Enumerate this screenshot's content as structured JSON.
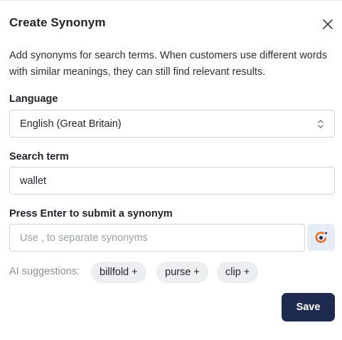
{
  "dialog": {
    "title": "Create Synonym",
    "close_icon": "close-icon",
    "description": "Add synonyms for search terms. When customers use different words with similar meanings, they can still find relevant results."
  },
  "language": {
    "label": "Language",
    "selected": "English (Great Britain)",
    "chevron_icon": "chevron-up-down-icon"
  },
  "search_term": {
    "label": "Search term",
    "value": "wallet"
  },
  "synonym": {
    "label": "Press Enter to submit a synonym",
    "placeholder": "Use , to separate synonyms",
    "ai_icon": "ai-sparkle-icon"
  },
  "ai_suggestions": {
    "label": "AI suggestions:",
    "items": [
      "billfold +",
      "purse +",
      "clip +"
    ]
  },
  "actions": {
    "save_label": "Save"
  },
  "colors": {
    "primary": "#1e2a4f",
    "chip_bg": "#eceef0",
    "ai_button_bg": "#e6ecf3",
    "ai_icon_orange": "#f26b1d",
    "ai_icon_dark": "#1e2a4f"
  }
}
